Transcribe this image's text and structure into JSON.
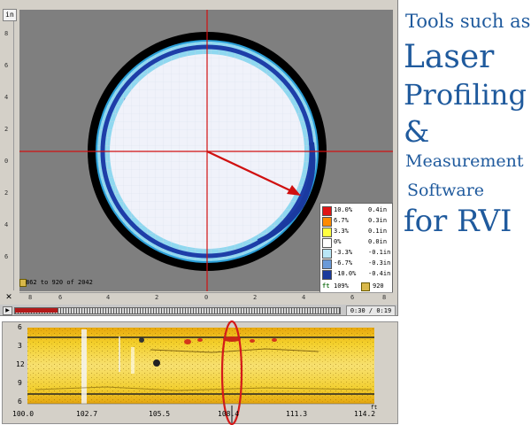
{
  "window": {
    "units_label": "in",
    "y_ruler": [
      "8",
      "6",
      "4",
      "2",
      "0",
      "2",
      "4",
      "6"
    ],
    "x_ruler": [
      "8",
      "6",
      "4",
      "2",
      "0",
      "2",
      "4",
      "6",
      "8"
    ],
    "frame_range": "862 to 920 of 2042",
    "close_glyph": "✕"
  },
  "legend": {
    "rows": [
      {
        "pct": "10.0%",
        "inch": "0.4in",
        "color": "#e01414"
      },
      {
        "pct": "6.7%",
        "inch": "0.3in",
        "color": "#ff8a00"
      },
      {
        "pct": "3.3%",
        "inch": "0.1in",
        "color": "#ffff40"
      },
      {
        "pct": "0%",
        "inch": "0.0in",
        "color": "#ffffff"
      },
      {
        "pct": "-3.3%",
        "inch": "-0.1in",
        "color": "#b9e6f5"
      },
      {
        "pct": "-6.7%",
        "inch": "-0.3in",
        "color": "#6a9ad8"
      },
      {
        "pct": "-10.0%",
        "inch": "-0.4in",
        "color": "#1a3a9c"
      }
    ],
    "unit": "ft",
    "footer_pct": "109%",
    "footer_frame": "920"
  },
  "playback": {
    "time": "0:30 / 0:19",
    "progress": 0.13
  },
  "strip": {
    "y_ticks": [
      "6",
      "3",
      "12",
      "9",
      "6"
    ],
    "x_ticks": [
      "100.0",
      "102.7",
      "105.5",
      "108.4",
      "111.3",
      "114.2"
    ],
    "x_unit": "ft"
  },
  "caption": {
    "line1": "Tools such as",
    "line2": "Laser",
    "line3": "Profiling",
    "line4": "&",
    "line5": "Measurement",
    "line6": "Software",
    "line7": "for RVI"
  },
  "colors": {
    "caption": "#1f5a9d",
    "crosshair": "#d01010",
    "ring_dark": "#1434a0",
    "ring_light": "#6ed0ee"
  }
}
